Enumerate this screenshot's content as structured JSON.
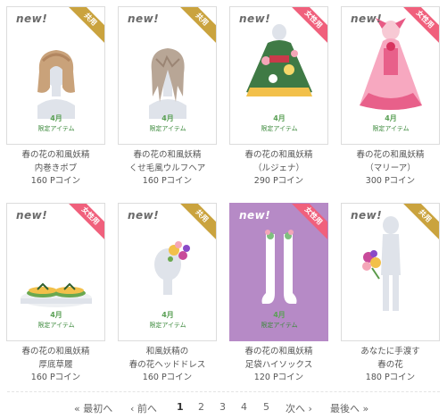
{
  "items": [
    {
      "new": "new!",
      "ribbon": "共用",
      "ribbon_color": "#caa33e",
      "month": "4月",
      "limited": "限定アイテム",
      "line1": "春の花の和風妖精",
      "line2": "内巻きボブ",
      "price": "160 Pコイン",
      "art": "bob-hair"
    },
    {
      "new": "new!",
      "ribbon": "共用",
      "ribbon_color": "#caa33e",
      "month": "4月",
      "limited": "限定アイテム",
      "line1": "春の花の和風妖精",
      "line2": "くせ毛風ウルフヘア",
      "price": "160 Pコイン",
      "art": "wolf-hair"
    },
    {
      "new": "new!",
      "ribbon": "女性用",
      "ribbon_color": "#f0607c",
      "month": "4月",
      "limited": "限定アイテム",
      "line1": "春の花の和風妖精",
      "line2": "（ルジェナ）",
      "price": "290 Pコイン",
      "art": "green-kimono"
    },
    {
      "new": "new!",
      "ribbon": "女性用",
      "ribbon_color": "#f0607c",
      "month": "4月",
      "limited": "限定アイテム",
      "line1": "春の花の和風妖精",
      "line2": "（マリーア）",
      "price": "300 Pコイン",
      "art": "pink-dress"
    },
    {
      "new": "new!",
      "ribbon": "女性用",
      "ribbon_color": "#f0607c",
      "month": "4月",
      "limited": "限定アイテム",
      "line1": "春の花の和風妖精",
      "line2": "厚底草履",
      "price": "160 Pコイン",
      "art": "zori-sandals"
    },
    {
      "new": "new!",
      "ribbon": "共用",
      "ribbon_color": "#caa33e",
      "month": "4月",
      "limited": "限定アイテム",
      "line1": "和風妖精の",
      "line2": "春の花ヘッドドレス",
      "price": "160 Pコイン",
      "art": "flower-headdress"
    },
    {
      "new": "new!",
      "ribbon": "女性用",
      "ribbon_color": "#f0607c",
      "month": "4月",
      "limited": "限定アイテム",
      "line1": "春の花の和風妖精",
      "line2": "足袋ハイソックス",
      "price": "120 Pコイン",
      "art": "tabi-socks"
    },
    {
      "new": "new!",
      "ribbon": "共用",
      "ribbon_color": "#caa33e",
      "month": "",
      "limited": "",
      "line1": "あなたに手渡す",
      "line2": "春の花",
      "price": "180 Pコイン",
      "art": "flower-bouquet"
    }
  ],
  "pager": {
    "first": "« 最初へ",
    "prev": "‹ 前へ",
    "pages": [
      "1",
      "2",
      "3",
      "4",
      "5"
    ],
    "current": "1",
    "next": "次へ ›",
    "last": "最後へ »"
  }
}
